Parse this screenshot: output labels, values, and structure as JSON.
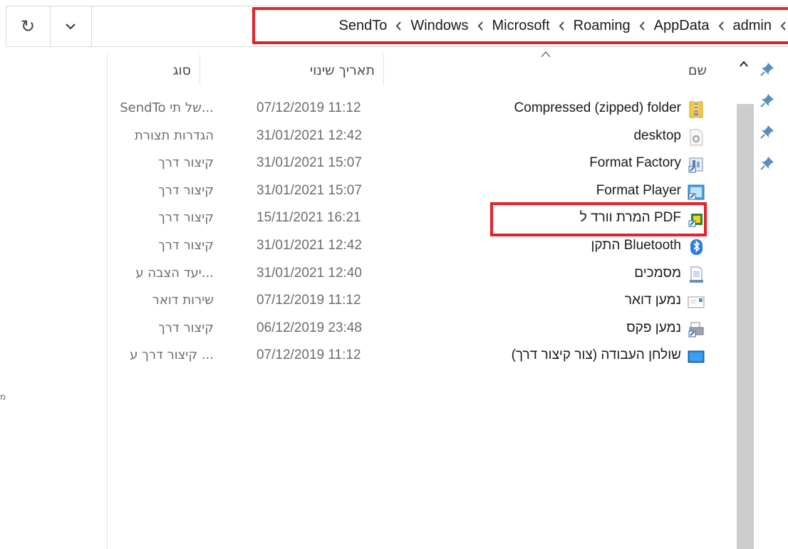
{
  "toolbar": {
    "refresh_glyph": "↻",
    "breadcrumb": [
      "SendTo",
      "Windows",
      "Microsoft",
      "Roaming",
      "AppData",
      "admin"
    ]
  },
  "columns": {
    "name": "שם",
    "date": "תאריך שינוי",
    "type": "סוג"
  },
  "rows": [
    {
      "name": "Compressed (zipped) folder",
      "date": "07/12/2019 11:12",
      "type": "...של תי SendTo",
      "icon": "zip-folder-icon"
    },
    {
      "name": "desktop",
      "date": "31/01/2021 12:42",
      "type": "הגדרות תצורת",
      "icon": "config-file-icon"
    },
    {
      "name": "Format Factory",
      "date": "31/01/2021 15:07",
      "type": "קיצור דרך",
      "icon": "format-factory-icon"
    },
    {
      "name": "Format Player",
      "date": "31/01/2021 15:07",
      "type": "קיצור דרך",
      "icon": "format-player-icon"
    },
    {
      "name": "PDF המרת וורד ל",
      "date": "15/11/2021 16:21",
      "type": "קיצור דרך",
      "icon": "pdf-converter-icon"
    },
    {
      "name": "Bluetooth התקן",
      "date": "31/01/2021 12:42",
      "type": "קיצור דרך",
      "icon": "bluetooth-icon"
    },
    {
      "name": "מסמכים",
      "date": "31/01/2021 12:40",
      "type": "...יעד הצבה ע",
      "icon": "documents-icon"
    },
    {
      "name": "נמען דואר",
      "date": "07/12/2019 11:12",
      "type": "שירות דואר",
      "icon": "mail-icon"
    },
    {
      "name": "נמען פקס",
      "date": "06/12/2019 23:48",
      "type": "קיצור דרך",
      "icon": "fax-icon"
    },
    {
      "name": "שולחן העבודה (צור קיצור דרך)",
      "date": "07/12/2019 11:12",
      "type": "... קיצור דרך ע",
      "icon": "desktop-icon"
    }
  ],
  "left_pane": {
    "stray_glyph": "מ"
  },
  "colors": {
    "highlight": "#e2232a",
    "scroll_thumb": "#cdcdcd",
    "pin": "#5a8dbf"
  }
}
